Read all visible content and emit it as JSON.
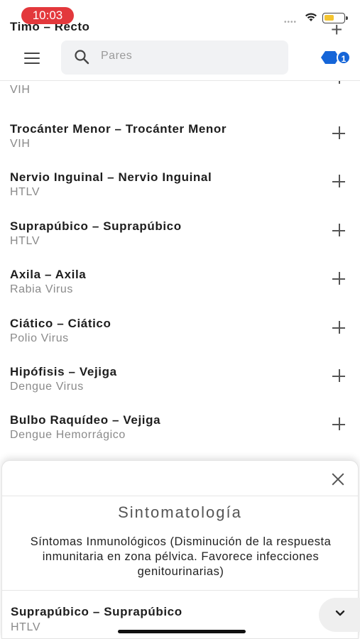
{
  "status_bar": {
    "time": "10:03",
    "signal": "••••"
  },
  "peek_row": {
    "title": "Timo – Recto"
  },
  "header": {
    "search_placeholder": "Pares",
    "badge_count": "1"
  },
  "list": {
    "first_sub": "VIH",
    "items": [
      {
        "title": "Trocánter Menor – Trocánter Menor",
        "sub": "VIH"
      },
      {
        "title": "Nervio Inguinal – Nervio Inguinal",
        "sub": "HTLV"
      },
      {
        "title": "Suprapúbico – Suprapúbico",
        "sub": "HTLV"
      },
      {
        "title": "Axila – Axila",
        "sub": "Rabia Virus"
      },
      {
        "title": "Ciático – Ciático",
        "sub": "Polio Virus"
      },
      {
        "title": "Hipófisis – Vejiga",
        "sub": "Dengue Virus"
      },
      {
        "title": "Bulbo Raquídeo – Vejiga",
        "sub": "Dengue Hemorrágico"
      }
    ]
  },
  "sheet": {
    "title": "Sintomatología",
    "description": "Síntomas Inmunológicos (Disminución de la respuesta inmunitaria en zona pélvica. Favorece infecciones genitourinarias)",
    "item_title": "Suprapúbico – Suprapúbico",
    "item_sub": "HTLV"
  },
  "colors": {
    "time_pill": "#e3383c",
    "badge": "#1565d8",
    "battery": "#f4c430"
  }
}
